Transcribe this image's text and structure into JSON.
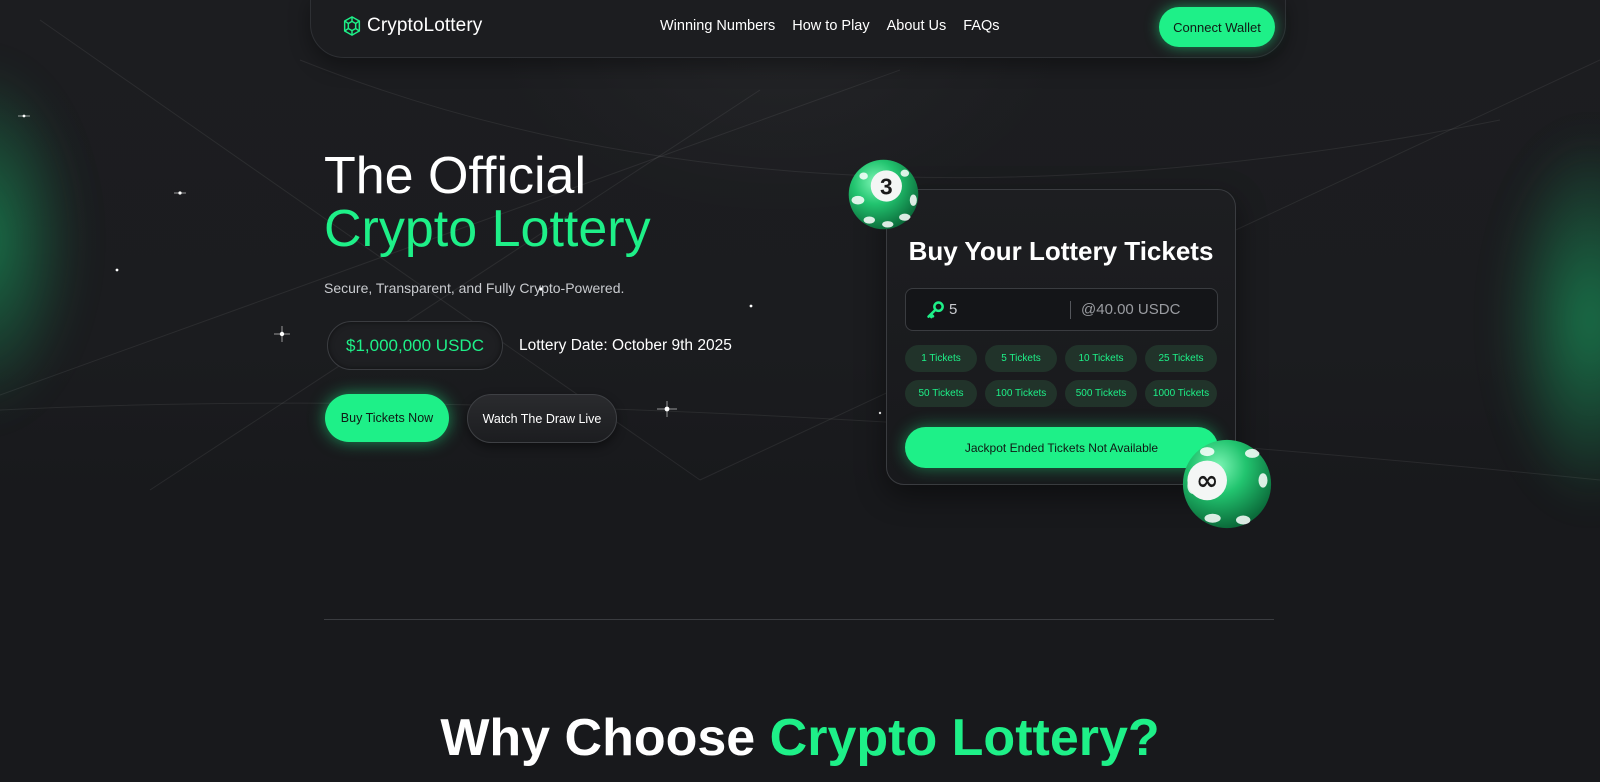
{
  "nav": {
    "logo_text": "CryptoLottery",
    "links": [
      "Winning Numbers",
      "How to Play",
      "About Us",
      "FAQs"
    ],
    "connect_label": "Connect Wallet"
  },
  "hero": {
    "title_line1": "The Official",
    "title_line2": "Crypto Lottery",
    "subtitle": "Secure, Transparent, and Fully Crypto-Powered.",
    "prize": "$1,000,000 USDC",
    "lottery_date": "Lottery Date: October 9th 2025",
    "buy_label": "Buy Tickets Now",
    "watch_label": "Watch The Draw Live"
  },
  "ticket_card": {
    "title": "Buy Your Lottery Tickets",
    "quantity": "5",
    "price": "@40.00 USDC",
    "presets": [
      "1 Tickets",
      "5 Tickets",
      "10 Tickets",
      "25 Tickets",
      "50 Tickets",
      "100 Tickets",
      "500 Tickets",
      "1000 Tickets"
    ],
    "jackpot_label": "Jackpot Ended Tickets Not Available",
    "ball_top_number": "3",
    "ball_bottom_symbol": "∞"
  },
  "why": {
    "title_white": "Why Choose ",
    "title_green": "Crypto Lottery?"
  },
  "colors": {
    "accent": "#1ef088",
    "background": "#18191c",
    "card_border": "#3a3c40",
    "preset_bg": "#21332a"
  },
  "icons": {
    "logo": "cube-network-icon",
    "quantity": "key-icon",
    "ball_top": "lottery-ball-icon",
    "ball_bottom": "lottery-ball-icon"
  }
}
